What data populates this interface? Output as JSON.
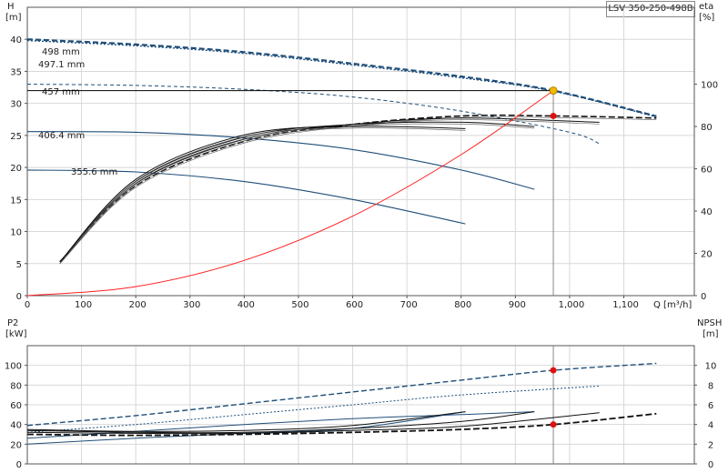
{
  "title": "LSV 350-250-498B",
  "chart_data": [
    {
      "type": "line",
      "name_label": "upper",
      "xlabel": "Q [m³/h]",
      "ylabel_left_top": "H",
      "ylabel_left_unit": "[m]",
      "ylabel_right_top": "eta",
      "ylabel_right_unit": "[%]",
      "xlim": [
        0,
        1230
      ],
      "ylim_left": [
        0,
        45
      ],
      "ylim_right": [
        0,
        100
      ],
      "x_ticks": [
        "0",
        "100",
        "200",
        "300",
        "400",
        "500",
        "600",
        "700",
        "800",
        "900",
        "1,000",
        "1,100"
      ],
      "x_tick_values": [
        0,
        100,
        200,
        300,
        400,
        500,
        600,
        700,
        800,
        900,
        1000,
        1100
      ],
      "y_ticks_left": [
        0,
        5,
        10,
        15,
        20,
        25,
        30,
        35,
        40
      ],
      "y_ticks_right": [
        0,
        20,
        40,
        60,
        80,
        100
      ],
      "head_curves": [
        {
          "label": "498 mm",
          "style": "dashed-bold",
          "color": "#1f4e79",
          "x": [
            0,
            200,
            400,
            600,
            800,
            970,
            1160
          ],
          "y": [
            40,
            39.2,
            38.0,
            36.2,
            34.2,
            32.0,
            28.0
          ]
        },
        {
          "label": "497.1 mm",
          "style": "dotted",
          "color": "#1f4e79",
          "x": [
            0,
            200,
            400,
            600,
            800,
            970,
            1160
          ],
          "y": [
            39.8,
            39.0,
            37.8,
            36.0,
            34.0,
            31.9,
            27.9
          ]
        },
        {
          "label": "457 mm",
          "style": "thin-dashed",
          "color": "#1f4e79",
          "x": [
            0,
            200,
            400,
            600,
            800,
            1000,
            1055
          ],
          "y": [
            33,
            32.8,
            32.2,
            31.0,
            28.8,
            25.5,
            23.7
          ]
        },
        {
          "label": "406.4 mm",
          "style": "solid-then-dashed",
          "color": "#1f4e79",
          "x": [
            0,
            200,
            400,
            600,
            800,
            935
          ],
          "y": [
            25.6,
            25.5,
            24.6,
            22.8,
            19.6,
            16.6
          ]
        },
        {
          "label": "355.6 mm",
          "style": "solid",
          "color": "#1f4e79",
          "x": [
            0,
            200,
            400,
            600,
            808
          ],
          "y": [
            19.6,
            19.3,
            17.8,
            15.0,
            11.2
          ]
        }
      ],
      "eta_curves": [
        {
          "label": "498 mm",
          "x": [
            60,
            200,
            400,
            600,
            800,
            970,
            1160
          ],
          "y": [
            16,
            52,
            73,
            81,
            85,
            85,
            84
          ]
        },
        {
          "label": "457 mm",
          "x": [
            60,
            200,
            400,
            600,
            800,
            1055
          ],
          "y": [
            16,
            53,
            74,
            81,
            84,
            82
          ]
        },
        {
          "label": "406.4 mm",
          "x": [
            60,
            200,
            400,
            600,
            800,
            935
          ],
          "y": [
            16,
            54,
            75,
            81,
            82,
            80
          ]
        },
        {
          "label": "355.6 mm",
          "x": [
            60,
            200,
            400,
            600,
            808
          ],
          "y": [
            16,
            55,
            76,
            80,
            79
          ]
        }
      ],
      "system_curve": {
        "color": "#ff2020",
        "x": [
          0,
          200,
          400,
          600,
          800,
          970
        ],
        "y": [
          0,
          1.4,
          5.5,
          12.4,
          22.0,
          32.0
        ]
      },
      "duty_point": {
        "q": 970,
        "h": 32.0,
        "eta": 85
      }
    },
    {
      "type": "line",
      "name_label": "lower",
      "ylabel_left_top": "P2",
      "ylabel_left_unit": "[kW]",
      "ylabel_right_top": "NPSH",
      "ylabel_right_unit": "[m]",
      "xlim": [
        0,
        1230
      ],
      "ylim_left": [
        0,
        120
      ],
      "ylim_right": [
        0,
        12
      ],
      "y_ticks_left": [
        0,
        20,
        40,
        60,
        80,
        100
      ],
      "y_ticks_right": [
        0,
        2,
        4,
        6,
        8,
        10
      ],
      "power_curves": [
        {
          "label": "498 mm",
          "x": [
            0,
            200,
            400,
            600,
            800,
            970,
            1160
          ],
          "y": [
            39,
            49,
            61,
            73,
            85,
            95,
            102
          ]
        },
        {
          "label": "457 mm",
          "x": [
            0,
            200,
            400,
            600,
            800,
            1055
          ],
          "y": [
            32,
            40,
            50,
            60,
            70,
            79
          ]
        },
        {
          "label": "406.4 mm",
          "x": [
            0,
            200,
            400,
            600,
            800,
            935
          ],
          "y": [
            26,
            33,
            40,
            46,
            50,
            53
          ]
        },
        {
          "label": "355.6 mm",
          "x": [
            0,
            200,
            400,
            600,
            808
          ],
          "y": [
            20,
            26,
            31,
            36,
            53
          ]
        }
      ],
      "npsh_curves": [
        {
          "label": "498 mm",
          "x": [
            0,
            200,
            400,
            600,
            800,
            970,
            1160
          ],
          "y": [
            3.0,
            2.9,
            3.0,
            3.2,
            3.5,
            4.0,
            5.1
          ]
        },
        {
          "label": "457 mm",
          "x": [
            0,
            200,
            400,
            600,
            800,
            1055
          ],
          "y": [
            3.2,
            3.1,
            3.1,
            3.4,
            3.8,
            5.2
          ]
        },
        {
          "label": "406.4 mm",
          "x": [
            0,
            200,
            400,
            600,
            800,
            935
          ],
          "y": [
            3.4,
            3.2,
            3.2,
            3.6,
            4.3,
            5.3
          ]
        },
        {
          "label": "355.6 mm",
          "x": [
            0,
            200,
            400,
            600,
            808
          ],
          "y": [
            3.5,
            3.3,
            3.4,
            3.9,
            5.3
          ]
        }
      ],
      "duty_point": {
        "q": 970,
        "p2": 95,
        "npsh": 4.0
      }
    }
  ]
}
